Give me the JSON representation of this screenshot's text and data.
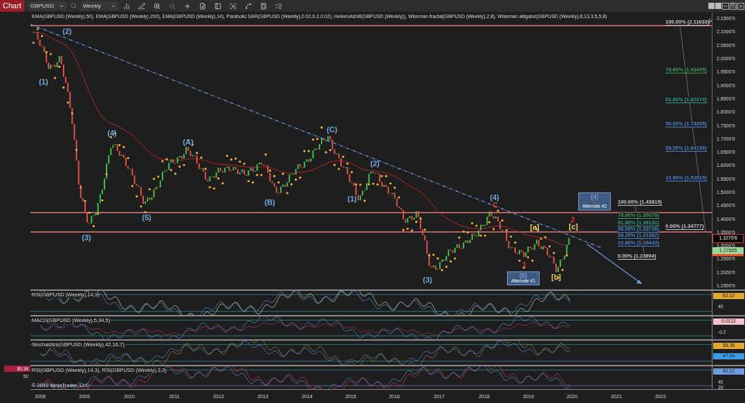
{
  "toolbar": {
    "title": "Chart",
    "instrument": "GBPUSD",
    "interval": "Weekly"
  },
  "price_panel": {
    "indicators": "EMA(GBPUSD (Weekly),50), EMA(GBPUSD (Weekly),200), EMA(GBPUSD (Weekly),14), Parabolic SAR(GBPUSD (Weekly),0.02,0.2,0.02), HeikenAshi8(GBPUSD (Weekly)), Wiseman fractal(GBPUSD (Weekly),2,8), Wiseman alligator(GBPUSD (Weekly),8,13,3,5,5,8)",
    "axis_labels": [
      "2.1500'0",
      "2.1000'0",
      "2.0500'0",
      "2.0000'0",
      "1.9500'0",
      "1.9000'0",
      "1.8500'0",
      "1.8000'0",
      "1.7500'0",
      "1.7000'0",
      "1.6500'0",
      "1.6000'0",
      "1.5500'0",
      "1.5000'0",
      "1.4500'0",
      "1.4000'0",
      "1.3500'0",
      "1.3000'0",
      "1.2500'0",
      "1.2000'0",
      "1.1500'0"
    ],
    "price_badges": [
      {
        "text": "1.3270'6",
        "kind": "last"
      },
      {
        "text": "1.27665",
        "kind": "indicator"
      }
    ],
    "wave_labels": [
      {
        "text": "(1)",
        "color": "#6fa8dc"
      },
      {
        "text": "(2)",
        "color": "#6fa8dc"
      },
      {
        "text": "(3)",
        "color": "#6fa8dc"
      },
      {
        "text": "(4)",
        "color": "#6fa8dc"
      },
      {
        "text": "(5)",
        "color": "#6fa8dc"
      },
      {
        "text": "(A)",
        "color": "#6fa8dc"
      },
      {
        "text": "(B)",
        "color": "#6fa8dc"
      },
      {
        "text": "(C)",
        "color": "#6fa8dc"
      },
      {
        "text": "(1)",
        "color": "#6fa8dc"
      },
      {
        "text": "(2)",
        "color": "#6fa8dc"
      },
      {
        "text": "(3)",
        "color": "#6fa8dc"
      },
      {
        "text": "(4)",
        "color": "#6fa8dc"
      },
      {
        "text": "C",
        "color": "#d03a3a"
      },
      {
        "text": "[a]",
        "color": "#e8d44d"
      },
      {
        "text": "1",
        "color": "#d03a3a"
      },
      {
        "text": "[b]",
        "color": "#e8d44d"
      },
      {
        "text": "2",
        "color": "#d03a3a"
      },
      {
        "text": "[c]",
        "color": "#e8d44d"
      }
    ],
    "alternates": [
      {
        "wave": "(5)",
        "label": "Alternate #1"
      },
      {
        "wave": "(4)",
        "sub": "C",
        "label": "Alternate #2"
      }
    ],
    "fib_upper": [
      {
        "text": "100.00% (2.11633)",
        "color": "#c8c8c8"
      },
      {
        "text": "78.60% (1.93495)",
        "color": "#3f9a5a"
      },
      {
        "text": "61.80% (1.82274)",
        "color": "#2f9a8a"
      },
      {
        "text": "50.00% (1.73205)",
        "color": "#4a82c8"
      },
      {
        "text": "38.20% (1.64136)",
        "color": "#4a82c8"
      },
      {
        "text": "23.60% (1.52915)",
        "color": "#4a82c8"
      },
      {
        "text": "0.00% (1.34777)",
        "color": "#c8c8c8"
      }
    ],
    "fib_lower": [
      {
        "text": "100.00% (1.43819)",
        "color": "#c8c8c8"
      },
      {
        "text": "78.60% (1.39070)",
        "color": "#3f9a5a"
      },
      {
        "text": "61.80% (1.36131)",
        "color": "#2f9a8a"
      },
      {
        "text": "50.00% (1.33736)",
        "color": "#4a82c8"
      },
      {
        "text": "38.20% (1.31382)",
        "color": "#4a82c8"
      },
      {
        "text": "23.60% (1.28443)",
        "color": "#4a82c8"
      },
      {
        "text": "0.00% (1.23694)",
        "color": "#c8c8c8"
      }
    ]
  },
  "panels": [
    {
      "title": "RSI(GBPUSD (Weekly),14,3)",
      "axis_labels": [
        "40"
      ],
      "badges": [
        {
          "text": "62.12",
          "color": "#e0a82e"
        }
      ]
    },
    {
      "title": "MACD(GBPUSD (Weekly),5,34,5)",
      "axis_labels": [
        "-0.2"
      ],
      "badges": [
        {
          "text": "0.0112",
          "color": "#f4c2c8"
        }
      ]
    },
    {
      "title": "Stochastics(GBPUSD (Weekly),42,16,7)",
      "badges": [
        {
          "text": "88.36",
          "color": "#e0a82e"
        },
        {
          "text": "47.34",
          "color": "#3a9be8"
        }
      ]
    },
    {
      "title": "RSI(GBPUSD (Weekly),14,3), RSI(GBPUSD (Weekly),3,3)",
      "axis_labels": [
        "40",
        "20"
      ],
      "badges": [
        {
          "text": "62.12",
          "color": "#6f9be0"
        }
      ],
      "left_badge": "80.34",
      "left_label": "50",
      "footer": "© 2019 NinjaTrader, LLC"
    }
  ],
  "x_axis": [
    "2008",
    "2009",
    "2010",
    "2011",
    "2012",
    "2013",
    "2014",
    "2015",
    "2016",
    "2017",
    "2018",
    "2019",
    "2020",
    "2021",
    "2022"
  ]
}
